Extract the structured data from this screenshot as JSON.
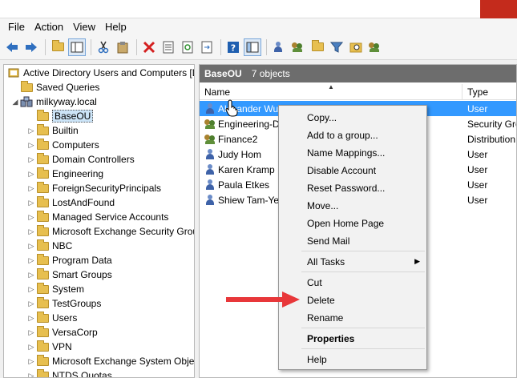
{
  "menubar": [
    "File",
    "Action",
    "View",
    "Help"
  ],
  "toolbar": {
    "icons": [
      "back-icon",
      "forward-icon",
      "up-folder-icon",
      "show-tree-icon",
      "cut-icon",
      "paste-icon",
      "delete-icon",
      "properties-icon",
      "refresh-icon",
      "export-icon",
      "help-icon",
      "console-tree-icon",
      "new-user-icon",
      "new-group-icon",
      "new-ou-icon",
      "filter-icon",
      "find-icon",
      "add-to-group-icon"
    ]
  },
  "tree": {
    "root": "Active Directory Users and Computers [D",
    "saved_queries": "Saved Queries",
    "domain": "milkyway.local",
    "items": [
      "BaseOU",
      "Builtin",
      "Computers",
      "Domain Controllers",
      "Engineering",
      "ForeignSecurityPrincipals",
      "LostAndFound",
      "Managed Service Accounts",
      "Microsoft Exchange Security Grou",
      "NBC",
      "Program Data",
      "Smart Groups",
      "System",
      "TestGroups",
      "Users",
      "VersaCorp",
      "VPN",
      "Microsoft Exchange System Obje",
      "NTDS Quotas"
    ]
  },
  "details": {
    "container": "BaseOU",
    "count": "7 objects",
    "col_name": "Name",
    "col_type": "Type",
    "rows": [
      {
        "name": "Alexander Wu",
        "type": "User",
        "icon": "user-icon"
      },
      {
        "name": "Engineering-D",
        "type": "Security Gro",
        "icon": "group-icon"
      },
      {
        "name": "Finance2",
        "type": "Distribution",
        "icon": "group-icon"
      },
      {
        "name": "Judy Hom",
        "type": "User",
        "icon": "user-icon"
      },
      {
        "name": "Karen Kramp",
        "type": "User",
        "icon": "user-icon"
      },
      {
        "name": "Paula Etkes",
        "type": "User",
        "icon": "user-icon"
      },
      {
        "name": "Shiew Tam-Ye",
        "type": "User",
        "icon": "user-icon"
      }
    ]
  },
  "context_menu": {
    "copy": "Copy...",
    "add_to_group": "Add to a group...",
    "name_mappings": "Name Mappings...",
    "disable_account": "Disable Account",
    "reset_password": "Reset Password...",
    "move": "Move...",
    "open_home_page": "Open Home Page",
    "send_mail": "Send Mail",
    "all_tasks": "All Tasks",
    "cut": "Cut",
    "delete": "Delete",
    "rename": "Rename",
    "properties": "Properties",
    "help": "Help"
  },
  "colors": {
    "selection": "#3399ff",
    "header_bar": "#6d6d6d",
    "annotation_arrow": "#e8373a"
  }
}
